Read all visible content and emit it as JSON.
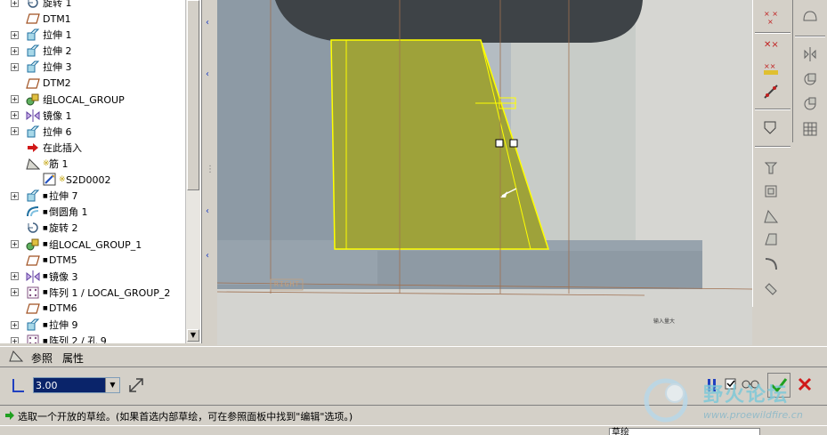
{
  "model_tree": {
    "items": [
      {
        "label": "旋转 1",
        "icon": "revolve-icon",
        "expand": true,
        "child": false,
        "marker": false
      },
      {
        "label": "DTM1",
        "icon": "datum-plane-icon",
        "expand": false,
        "child": false,
        "marker": false
      },
      {
        "label": "拉伸 1",
        "icon": "extrude-icon",
        "expand": true,
        "child": false,
        "marker": false
      },
      {
        "label": "拉伸 2",
        "icon": "extrude-icon",
        "expand": true,
        "child": false,
        "marker": false
      },
      {
        "label": "拉伸 3",
        "icon": "extrude-icon",
        "expand": true,
        "child": false,
        "marker": false
      },
      {
        "label": "DTM2",
        "icon": "datum-plane-icon",
        "expand": false,
        "child": false,
        "marker": false
      },
      {
        "label": "组LOCAL_GROUP",
        "icon": "group-icon",
        "expand": true,
        "child": false,
        "marker": false
      },
      {
        "label": "镜像 1",
        "icon": "mirror-icon",
        "expand": true,
        "child": false,
        "marker": false
      },
      {
        "label": "拉伸 6",
        "icon": "extrude-icon",
        "expand": true,
        "child": false,
        "marker": false
      },
      {
        "label": "在此插入",
        "icon": "insert-here-icon",
        "expand": false,
        "child": false,
        "marker": false
      },
      {
        "label": "筋 1",
        "icon": "rib-icon",
        "expand": false,
        "child": false,
        "marker": true
      },
      {
        "label": "S2D0002",
        "icon": "sketch-icon",
        "expand": false,
        "child": true,
        "marker": true
      },
      {
        "label": "拉伸 7",
        "icon": "extrude-icon",
        "expand": true,
        "child": false,
        "marker": true
      },
      {
        "label": "倒圆角 1",
        "icon": "round-icon",
        "expand": false,
        "child": false,
        "marker": true
      },
      {
        "label": "旋转 2",
        "icon": "revolve-icon",
        "expand": false,
        "child": false,
        "marker": true
      },
      {
        "label": "组LOCAL_GROUP_1",
        "icon": "group-icon",
        "expand": true,
        "child": false,
        "marker": true
      },
      {
        "label": "DTM5",
        "icon": "datum-plane-icon",
        "expand": false,
        "child": false,
        "marker": true
      },
      {
        "label": "镜像 3",
        "icon": "mirror-icon",
        "expand": true,
        "child": false,
        "marker": true
      },
      {
        "label": "阵列 1 / LOCAL_GROUP_2",
        "icon": "pattern-icon",
        "expand": true,
        "child": false,
        "marker": true
      },
      {
        "label": "DTM6",
        "icon": "datum-plane-icon",
        "expand": false,
        "child": false,
        "marker": true
      },
      {
        "label": "拉伸 9",
        "icon": "extrude-icon",
        "expand": true,
        "child": false,
        "marker": true
      },
      {
        "label": "阵列 2 / 孔 9",
        "icon": "pattern-icon",
        "expand": true,
        "child": false,
        "marker": true
      }
    ]
  },
  "viewport": {
    "right_label": "RIGHT",
    "small_note": "输入量大"
  },
  "dashboard": {
    "tab_references": "参照",
    "tab_properties": "属性",
    "thickness_value": "3.00"
  },
  "status": {
    "message": "选取一个开放的草绘。(如果首选内部草绘，可在参照面板中找到\"编辑\"选项。)",
    "filter_value": "草绘"
  },
  "watermark": {
    "title": "野火论坛",
    "url": "www.proewildfire.cn"
  },
  "colors": {
    "rib_fill": "#9ea23a",
    "rib_edge": "#ffff00",
    "selection_bg": "#0a246a",
    "accept_green": "#1ea01e",
    "cancel_red": "#d01818"
  }
}
